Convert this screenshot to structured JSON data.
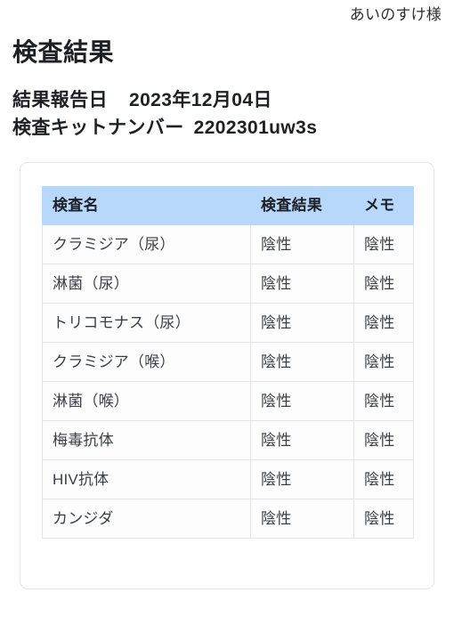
{
  "account": {
    "user_label": "あいのすけ様"
  },
  "header": {
    "title": "検査結果",
    "report_date_label": "結果報告日",
    "report_date_value": "2023年12月04日",
    "kit_number_label": "検査キットナンバー",
    "kit_number_value": "2202301uw3s"
  },
  "table": {
    "columns": [
      {
        "key": "name",
        "label": "検査名"
      },
      {
        "key": "result",
        "label": "検査結果"
      },
      {
        "key": "memo",
        "label": "メモ"
      }
    ],
    "rows": [
      {
        "name": "クラミジア（尿）",
        "result": "陰性",
        "memo": "陰性"
      },
      {
        "name": "淋菌（尿）",
        "result": "陰性",
        "memo": "陰性"
      },
      {
        "name": "トリコモナス（尿）",
        "result": "陰性",
        "memo": "陰性"
      },
      {
        "name": "クラミジア（喉）",
        "result": "陰性",
        "memo": "陰性"
      },
      {
        "name": "淋菌（喉）",
        "result": "陰性",
        "memo": "陰性"
      },
      {
        "name": "梅毒抗体",
        "result": "陰性",
        "memo": "陰性"
      },
      {
        "name": "HIV抗体",
        "result": "陰性",
        "memo": "陰性"
      },
      {
        "name": "カンジダ",
        "result": "陰性",
        "memo": "陰性"
      }
    ]
  },
  "colors": {
    "table_header_bg": "#b8d8fb",
    "card_border": "#e6e6e6",
    "cell_border": "#e3e5e8",
    "text_primary": "#1d2024",
    "text_cell": "#3a3f46",
    "page_bg": "#ffffff"
  }
}
